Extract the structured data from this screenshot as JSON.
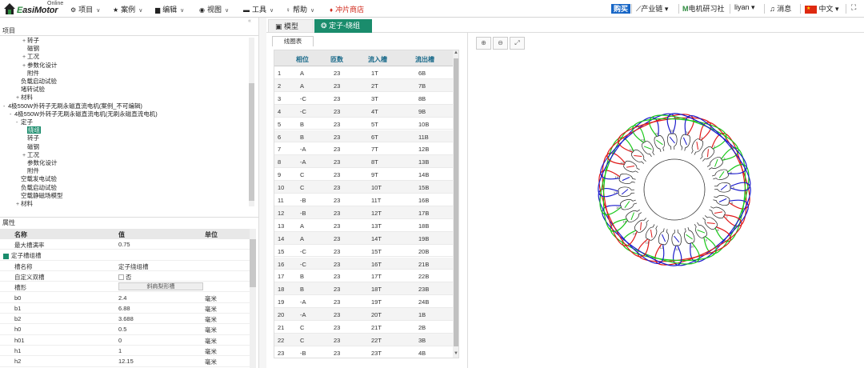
{
  "topbar": {
    "logo_brand_first": "E",
    "logo_brand_rest": "asiMotor",
    "logo_online": "Online",
    "menu": [
      {
        "icon": "gear-icon",
        "label": "项目"
      },
      {
        "icon": "star-icon",
        "label": "案例"
      },
      {
        "icon": "edit-icon",
        "label": "编辑"
      },
      {
        "icon": "eye-icon",
        "label": "视图"
      },
      {
        "icon": "toolbox-icon",
        "label": "工具"
      },
      {
        "icon": "bulb-icon",
        "label": "帮助"
      },
      {
        "icon": "fire-icon",
        "label": "冲片商店"
      }
    ],
    "buy_label": "购买",
    "industry_chain": "产业链",
    "research_club": "电机研习社",
    "user_name": "liyan",
    "messages": "消息",
    "language": "中文"
  },
  "left": {
    "tree_header": "项目",
    "tree_items": [
      {
        "level": 3,
        "toggle": "+",
        "label": "转子"
      },
      {
        "level": 3,
        "toggle": "",
        "label": "磁钢"
      },
      {
        "level": 3,
        "toggle": "+",
        "label": "工况"
      },
      {
        "level": 3,
        "toggle": "+",
        "label": "参数化设计"
      },
      {
        "level": 3,
        "toggle": "",
        "label": "附件"
      },
      {
        "level": 2,
        "toggle": "",
        "label": "负载启动试验"
      },
      {
        "level": 2,
        "toggle": "",
        "label": "堵转试验"
      },
      {
        "level": 2,
        "toggle": "+",
        "label": "材料"
      },
      {
        "level": 0,
        "toggle": "-",
        "label": "4极550W外转子无刷永磁直流电机(案例_不可编辑)"
      },
      {
        "level": 1,
        "toggle": "-",
        "label": "4极550W外转子无刷永磁直流电机(无刷永磁直流电机)"
      },
      {
        "level": 2,
        "toggle": "-",
        "label": "定子"
      },
      {
        "level": 3,
        "toggle": "",
        "label": "绕组",
        "selected": true
      },
      {
        "level": 3,
        "toggle": "",
        "label": "转子"
      },
      {
        "level": 3,
        "toggle": "",
        "label": "磁钢"
      },
      {
        "level": 3,
        "toggle": "+",
        "label": "工况"
      },
      {
        "level": 3,
        "toggle": "",
        "label": "参数化设计"
      },
      {
        "level": 3,
        "toggle": "",
        "label": "附件"
      },
      {
        "level": 2,
        "toggle": "",
        "label": "空载发电试验"
      },
      {
        "level": 2,
        "toggle": "",
        "label": "负载启动试验"
      },
      {
        "level": 2,
        "toggle": "",
        "label": "空载静磁场模型"
      },
      {
        "level": 2,
        "toggle": "+",
        "label": "材料"
      }
    ],
    "prop_header": "属性",
    "prop_columns": {
      "name": "名称",
      "value": "值",
      "unit": "单位"
    },
    "prop_rows": [
      {
        "name": "最大槽满率",
        "value": "0.75",
        "unit": ""
      },
      {
        "name": "定子槽组槽",
        "value": "",
        "unit": "",
        "group": true
      },
      {
        "name": "槽名称",
        "value": "定子绕组槽",
        "unit": ""
      },
      {
        "name": "自定义双槽",
        "value": "否",
        "unit": "",
        "checkbox": true
      },
      {
        "name": "槽形",
        "value": "",
        "unit": "",
        "button": "斜肩梨形槽"
      },
      {
        "name": "b0",
        "value": "2.4",
        "unit": "毫米"
      },
      {
        "name": "b1",
        "value": "6.88",
        "unit": "毫米"
      },
      {
        "name": "b2",
        "value": "3.688",
        "unit": "毫米"
      },
      {
        "name": "h0",
        "value": "0.5",
        "unit": "毫米"
      },
      {
        "name": "h01",
        "value": "0",
        "unit": "毫米"
      },
      {
        "name": "h1",
        "value": "1",
        "unit": "毫米"
      },
      {
        "name": "h2",
        "value": "12.15",
        "unit": "毫米"
      }
    ]
  },
  "main": {
    "tab_model": "模型",
    "tab_winding": "定子-绕组",
    "subtab": "线圈表",
    "table_columns": [
      "相位",
      "匝数",
      "流入槽",
      "流出槽"
    ],
    "table_rows": [
      [
        "1",
        "A",
        "23",
        "1T",
        "6B"
      ],
      [
        "2",
        "A",
        "23",
        "2T",
        "7B"
      ],
      [
        "3",
        "-C",
        "23",
        "3T",
        "8B"
      ],
      [
        "4",
        "-C",
        "23",
        "4T",
        "9B"
      ],
      [
        "5",
        "B",
        "23",
        "5T",
        "10B"
      ],
      [
        "6",
        "B",
        "23",
        "6T",
        "11B"
      ],
      [
        "7",
        "-A",
        "23",
        "7T",
        "12B"
      ],
      [
        "8",
        "-A",
        "23",
        "8T",
        "13B"
      ],
      [
        "9",
        "C",
        "23",
        "9T",
        "14B"
      ],
      [
        "10",
        "C",
        "23",
        "10T",
        "15B"
      ],
      [
        "11",
        "-B",
        "23",
        "11T",
        "16B"
      ],
      [
        "12",
        "-B",
        "23",
        "12T",
        "17B"
      ],
      [
        "13",
        "A",
        "23",
        "13T",
        "18B"
      ],
      [
        "14",
        "A",
        "23",
        "14T",
        "19B"
      ],
      [
        "15",
        "-C",
        "23",
        "15T",
        "20B"
      ],
      [
        "16",
        "-C",
        "23",
        "16T",
        "21B"
      ],
      [
        "17",
        "B",
        "23",
        "17T",
        "22B"
      ],
      [
        "18",
        "B",
        "23",
        "18T",
        "23B"
      ],
      [
        "19",
        "-A",
        "23",
        "19T",
        "24B"
      ],
      [
        "20",
        "-A",
        "23",
        "20T",
        "1B"
      ],
      [
        "21",
        "C",
        "23",
        "21T",
        "2B"
      ],
      [
        "22",
        "C",
        "23",
        "22T",
        "3B"
      ],
      [
        "23",
        "-B",
        "23",
        "23T",
        "4B"
      ]
    ],
    "colors": {
      "phase_a": "#e01818",
      "phase_b": "#1a1acc",
      "phase_c": "#18c818",
      "accent": "#1a8c6c"
    },
    "slot_count": 24,
    "coil_pitch": 5
  }
}
